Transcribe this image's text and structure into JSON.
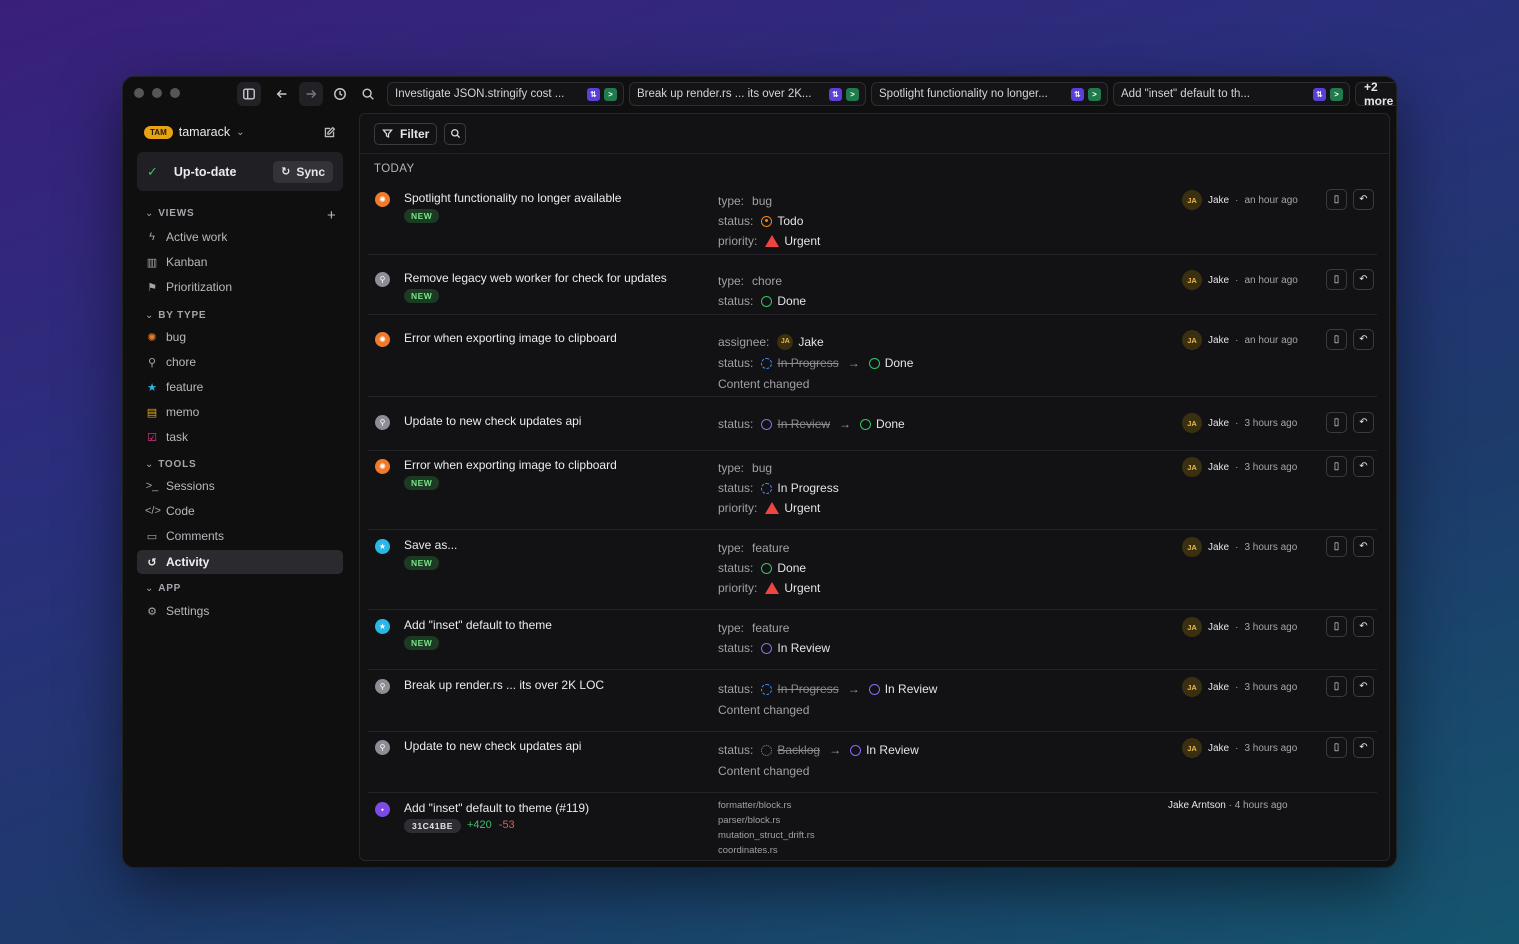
{
  "topbar": {
    "tabs": [
      {
        "label": "Investigate JSON.stringify cost ..."
      },
      {
        "label": "Break up render.rs ... its over 2K..."
      },
      {
        "label": "Spotlight functionality no longer..."
      },
      {
        "label": "Add \"inset\" default to th..."
      }
    ],
    "more_label": "+2 more"
  },
  "sidebar": {
    "workspace_badge": "TAM",
    "workspace_name": "tamarack",
    "sync_status": "Up-to-date",
    "sync_button": "Sync",
    "sections": {
      "views": "VIEWS",
      "by_type": "BY TYPE",
      "tools": "TOOLS",
      "app": "APP"
    },
    "views": [
      "Active work",
      "Kanban",
      "Prioritization"
    ],
    "types": [
      "bug",
      "chore",
      "feature",
      "memo",
      "task"
    ],
    "tools": [
      "Sessions",
      "Code",
      "Comments",
      "Activity"
    ],
    "app": [
      "Settings"
    ],
    "active_item": "Activity"
  },
  "main": {
    "filter_label": "Filter",
    "group_label": "TODAY",
    "new_badge": "NEW",
    "rows": [
      {
        "title": "Spotlight functionality no longer available",
        "type": "bug",
        "status": "Todo",
        "priority": "Urgent",
        "user": "Jake",
        "initials": "JA",
        "time": "an hour ago"
      },
      {
        "title": "Remove legacy web worker for check for updates",
        "type": "chore",
        "status": "Done",
        "user": "Jake",
        "initials": "JA",
        "time": "an hour ago"
      },
      {
        "title": "Error when exporting image to clipboard",
        "assignee": "Jake",
        "status_from": "In Progress",
        "status_to": "Done",
        "extra": "Content changed",
        "user": "Jake",
        "initials": "JA",
        "time": "an hour ago"
      },
      {
        "title": "Update to new check updates api",
        "status_from": "In Review",
        "status_to": "Done",
        "user": "Jake",
        "initials": "JA",
        "time": "3 hours ago"
      },
      {
        "title": "Error when exporting image to clipboard",
        "type": "bug",
        "status": "In Progress",
        "priority": "Urgent",
        "user": "Jake",
        "initials": "JA",
        "time": "3 hours ago"
      },
      {
        "title": "Save as...",
        "type": "feature",
        "status": "Done",
        "priority": "Urgent",
        "user": "Jake",
        "initials": "JA",
        "time": "3 hours ago"
      },
      {
        "title": "Add \"inset\" default to theme",
        "type": "feature",
        "status": "In Review",
        "user": "Jake",
        "initials": "JA",
        "time": "3 hours ago"
      },
      {
        "title": "Break up render.rs ... its over 2K LOC",
        "status_from": "In Progress",
        "status_to": "In Review",
        "extra": "Content changed",
        "user": "Jake",
        "initials": "JA",
        "time": "3 hours ago"
      },
      {
        "title": "Update to new check updates api",
        "status_from": "Backlog",
        "status_to": "In Review",
        "extra": "Content changed",
        "user": "Jake",
        "initials": "JA",
        "time": "3 hours ago"
      }
    ],
    "commit": {
      "title": "Add \"inset\" default to theme (#119)",
      "hash": "31C41BE",
      "additions": "+420",
      "deletions": "-53",
      "files": [
        "formatter/block.rs",
        "parser/block.rs",
        "mutation_struct_drift.rs",
        "coordinates.rs"
      ],
      "author": "Jake Arntson",
      "time": "4 hours ago"
    },
    "labels": {
      "type": "type:",
      "status": "status:",
      "priority": "priority:",
      "assignee": "assignee:"
    }
  }
}
